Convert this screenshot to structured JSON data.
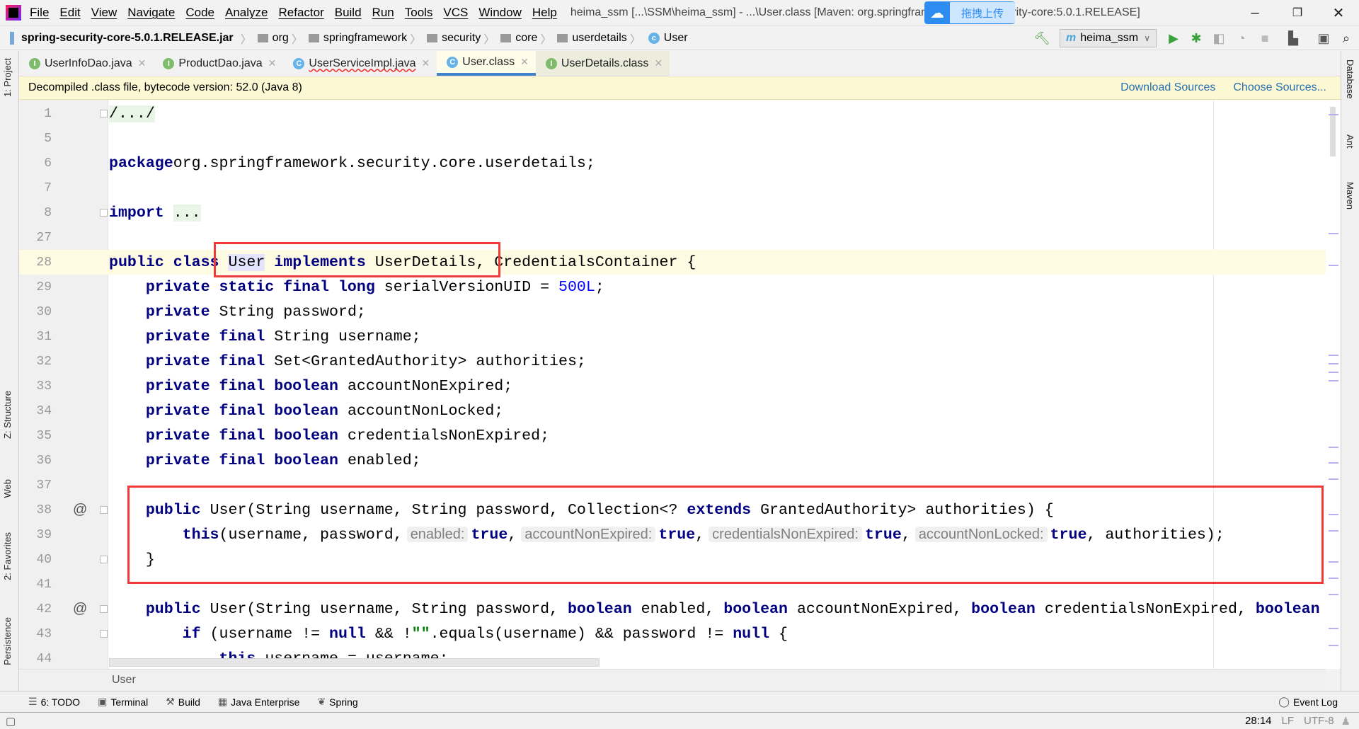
{
  "menu": [
    "File",
    "Edit",
    "View",
    "Navigate",
    "Code",
    "Analyze",
    "Refactor",
    "Build",
    "Run",
    "Tools",
    "VCS",
    "Window",
    "Help"
  ],
  "window_title": "heima_ssm [...\\SSM\\heima_ssm] - ...\\User.class [Maven: org.springframe",
  "window_title_tail": "ng-security-core:5.0.1.RELEASE]",
  "cloud_upload_label": "拖拽上传",
  "breadcrumb": {
    "jar": "spring-security-core-5.0.1.RELEASE.jar",
    "folders": [
      "org",
      "springframework",
      "security",
      "core",
      "userdetails"
    ],
    "class": "User"
  },
  "run_config": "heima_ssm",
  "tabs": [
    {
      "label": "UserInfoDao.java",
      "icon": "I",
      "active": false
    },
    {
      "label": "ProductDao.java",
      "icon": "I",
      "active": false
    },
    {
      "label": "UserServiceImpl.java",
      "icon": "C",
      "active": false,
      "error": true
    },
    {
      "label": "User.class",
      "icon": "C",
      "active": true
    },
    {
      "label": "UserDetails.class",
      "icon": "I",
      "active": false
    }
  ],
  "banner": {
    "text": "Decompiled .class file, bytecode version: 52.0 (Java 8)",
    "download": "Download Sources",
    "choose": "Choose Sources..."
  },
  "left_tools": [
    "1: Project",
    "Z: Structure",
    "Web",
    "2: Favorites",
    "Persistence"
  ],
  "right_tools": [
    "Database",
    "Ant",
    "Maven"
  ],
  "code": [
    {
      "n": "1",
      "fold": true,
      "t": [
        [
          "fold-txt",
          "/.../"
        ]
      ]
    },
    {
      "n": "5",
      "t": []
    },
    {
      "n": "6",
      "t": [
        [
          "kw",
          "package"
        ],
        [
          "",
          "org.springframework.security.core.userdetails;"
        ]
      ]
    },
    {
      "n": "7",
      "t": []
    },
    {
      "n": "8",
      "fold": true,
      "t": [
        [
          "kw",
          "import"
        ],
        [
          "",
          " "
        ],
        [
          "fold-txt",
          "..."
        ]
      ]
    },
    {
      "n": "27",
      "t": []
    },
    {
      "n": "28",
      "cur": true,
      "t": [
        [
          "kw",
          "public class"
        ],
        [
          "",
          " "
        ],
        [
          "sel",
          "User"
        ],
        [
          "",
          " "
        ],
        [
          "kw",
          "implements"
        ],
        [
          "",
          " UserDetails, CredentialsContainer {"
        ]
      ]
    },
    {
      "n": "29",
      "t": [
        [
          "",
          "    "
        ],
        [
          "kw",
          "private static final long"
        ],
        [
          "",
          " serialVersionUID = "
        ],
        [
          "num",
          "500L"
        ],
        [
          "",
          ";"
        ]
      ]
    },
    {
      "n": "30",
      "t": [
        [
          "",
          "    "
        ],
        [
          "kw",
          "private"
        ],
        [
          "",
          " String password;"
        ]
      ]
    },
    {
      "n": "31",
      "t": [
        [
          "",
          "    "
        ],
        [
          "kw",
          "private final"
        ],
        [
          "",
          " String username;"
        ]
      ]
    },
    {
      "n": "32",
      "t": [
        [
          "",
          "    "
        ],
        [
          "kw",
          "private final"
        ],
        [
          "",
          " Set<GrantedAuthority> authorities;"
        ]
      ]
    },
    {
      "n": "33",
      "t": [
        [
          "",
          "    "
        ],
        [
          "kw",
          "private final boolean"
        ],
        [
          "",
          " accountNonExpired;"
        ]
      ]
    },
    {
      "n": "34",
      "t": [
        [
          "",
          "    "
        ],
        [
          "kw",
          "private final boolean"
        ],
        [
          "",
          " accountNonLocked;"
        ]
      ]
    },
    {
      "n": "35",
      "t": [
        [
          "",
          "    "
        ],
        [
          "kw",
          "private final boolean"
        ],
        [
          "",
          " credentialsNonExpired;"
        ]
      ]
    },
    {
      "n": "36",
      "t": [
        [
          "",
          "    "
        ],
        [
          "kw",
          "private final boolean"
        ],
        [
          "",
          " enabled;"
        ]
      ]
    },
    {
      "n": "37",
      "t": []
    },
    {
      "n": "38",
      "ann": "@",
      "fold": true,
      "t": [
        [
          "",
          "    "
        ],
        [
          "kw",
          "public"
        ],
        [
          "",
          " User(String username, String password, Collection<? "
        ],
        [
          "kw",
          "extends"
        ],
        [
          "",
          " GrantedAuthority> authorities) {"
        ]
      ]
    },
    {
      "n": "39",
      "t": [
        [
          "",
          "        "
        ],
        [
          "kw",
          "this"
        ],
        [
          "",
          "(username, password,"
        ],
        [
          "hint",
          "enabled:"
        ],
        [
          "kw",
          "true"
        ],
        [
          "",
          ","
        ],
        [
          "hint",
          "accountNonExpired:"
        ],
        [
          "kw",
          "true"
        ],
        [
          "",
          ","
        ],
        [
          "hint",
          "credentialsNonExpired:"
        ],
        [
          "kw",
          "true"
        ],
        [
          "",
          ","
        ],
        [
          "hint",
          "accountNonLocked:"
        ],
        [
          "kw",
          "true"
        ],
        [
          "",
          ", authorities);"
        ]
      ]
    },
    {
      "n": "40",
      "fold": true,
      "t": [
        [
          "",
          "    }"
        ]
      ]
    },
    {
      "n": "41",
      "t": []
    },
    {
      "n": "42",
      "ann": "@",
      "fold": true,
      "t": [
        [
          "",
          "    "
        ],
        [
          "kw",
          "public"
        ],
        [
          "",
          " User(String username, String password, "
        ],
        [
          "kw",
          "boolean"
        ],
        [
          "",
          " enabled, "
        ],
        [
          "kw",
          "boolean"
        ],
        [
          "",
          " accountNonExpired, "
        ],
        [
          "kw",
          "boolean"
        ],
        [
          "",
          " credentialsNonExpired, "
        ],
        [
          "kw",
          "boolean"
        ],
        [
          "",
          " a"
        ]
      ]
    },
    {
      "n": "43",
      "fold": true,
      "t": [
        [
          "",
          "        "
        ],
        [
          "kw",
          "if"
        ],
        [
          "",
          " (username != "
        ],
        [
          "kw",
          "null"
        ],
        [
          "",
          " && !"
        ],
        [
          "str",
          "\"\""
        ],
        [
          "",
          ".equals(username) && password != "
        ],
        [
          "kw",
          "null"
        ],
        [
          "",
          " {"
        ]
      ]
    },
    {
      "n": "44",
      "t": [
        [
          "",
          "            "
        ],
        [
          "kw",
          "this"
        ],
        [
          "",
          ".username = username;"
        ]
      ]
    }
  ],
  "editor_breadcrumb": "User",
  "tool_windows": [
    {
      "label": "6: TODO",
      "icon": "list-icon"
    },
    {
      "label": "Terminal",
      "icon": "terminal-icon"
    },
    {
      "label": "Build",
      "icon": "hammer-icon"
    },
    {
      "label": "Java Enterprise",
      "icon": "java-enterprise-icon"
    },
    {
      "label": "Spring",
      "icon": "spring-icon"
    }
  ],
  "event_log": "Event Log",
  "status": {
    "position": "28:14",
    "line_sep": "LF",
    "encoding": "UTF-8"
  },
  "colors": {
    "keyword": "#000080",
    "number": "#0000ff",
    "highlight_box": "#f03a3a",
    "tab_active_underline": "#4083c9"
  }
}
